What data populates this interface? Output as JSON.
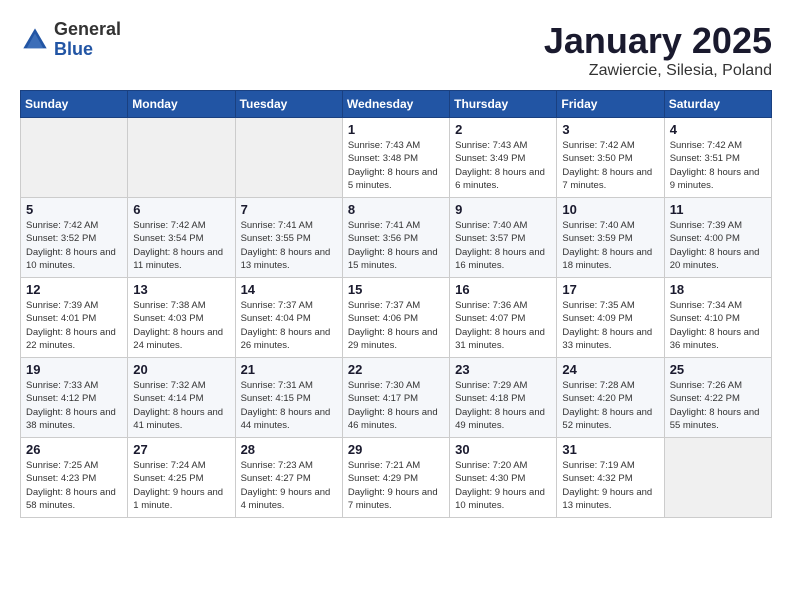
{
  "logo": {
    "general": "General",
    "blue": "Blue"
  },
  "header": {
    "title": "January 2025",
    "subtitle": "Zawiercie, Silesia, Poland"
  },
  "weekdays": [
    "Sunday",
    "Monday",
    "Tuesday",
    "Wednesday",
    "Thursday",
    "Friday",
    "Saturday"
  ],
  "weeks": [
    [
      {
        "day": "",
        "empty": true
      },
      {
        "day": "",
        "empty": true
      },
      {
        "day": "",
        "empty": true
      },
      {
        "day": "1",
        "sunrise": "7:43 AM",
        "sunset": "3:48 PM",
        "daylight": "8 hours and 5 minutes."
      },
      {
        "day": "2",
        "sunrise": "7:43 AM",
        "sunset": "3:49 PM",
        "daylight": "8 hours and 6 minutes."
      },
      {
        "day": "3",
        "sunrise": "7:42 AM",
        "sunset": "3:50 PM",
        "daylight": "8 hours and 7 minutes."
      },
      {
        "day": "4",
        "sunrise": "7:42 AM",
        "sunset": "3:51 PM",
        "daylight": "8 hours and 9 minutes."
      }
    ],
    [
      {
        "day": "5",
        "sunrise": "7:42 AM",
        "sunset": "3:52 PM",
        "daylight": "8 hours and 10 minutes."
      },
      {
        "day": "6",
        "sunrise": "7:42 AM",
        "sunset": "3:54 PM",
        "daylight": "8 hours and 11 minutes."
      },
      {
        "day": "7",
        "sunrise": "7:41 AM",
        "sunset": "3:55 PM",
        "daylight": "8 hours and 13 minutes."
      },
      {
        "day": "8",
        "sunrise": "7:41 AM",
        "sunset": "3:56 PM",
        "daylight": "8 hours and 15 minutes."
      },
      {
        "day": "9",
        "sunrise": "7:40 AM",
        "sunset": "3:57 PM",
        "daylight": "8 hours and 16 minutes."
      },
      {
        "day": "10",
        "sunrise": "7:40 AM",
        "sunset": "3:59 PM",
        "daylight": "8 hours and 18 minutes."
      },
      {
        "day": "11",
        "sunrise": "7:39 AM",
        "sunset": "4:00 PM",
        "daylight": "8 hours and 20 minutes."
      }
    ],
    [
      {
        "day": "12",
        "sunrise": "7:39 AM",
        "sunset": "4:01 PM",
        "daylight": "8 hours and 22 minutes."
      },
      {
        "day": "13",
        "sunrise": "7:38 AM",
        "sunset": "4:03 PM",
        "daylight": "8 hours and 24 minutes."
      },
      {
        "day": "14",
        "sunrise": "7:37 AM",
        "sunset": "4:04 PM",
        "daylight": "8 hours and 26 minutes."
      },
      {
        "day": "15",
        "sunrise": "7:37 AM",
        "sunset": "4:06 PM",
        "daylight": "8 hours and 29 minutes."
      },
      {
        "day": "16",
        "sunrise": "7:36 AM",
        "sunset": "4:07 PM",
        "daylight": "8 hours and 31 minutes."
      },
      {
        "day": "17",
        "sunrise": "7:35 AM",
        "sunset": "4:09 PM",
        "daylight": "8 hours and 33 minutes."
      },
      {
        "day": "18",
        "sunrise": "7:34 AM",
        "sunset": "4:10 PM",
        "daylight": "8 hours and 36 minutes."
      }
    ],
    [
      {
        "day": "19",
        "sunrise": "7:33 AM",
        "sunset": "4:12 PM",
        "daylight": "8 hours and 38 minutes."
      },
      {
        "day": "20",
        "sunrise": "7:32 AM",
        "sunset": "4:14 PM",
        "daylight": "8 hours and 41 minutes."
      },
      {
        "day": "21",
        "sunrise": "7:31 AM",
        "sunset": "4:15 PM",
        "daylight": "8 hours and 44 minutes."
      },
      {
        "day": "22",
        "sunrise": "7:30 AM",
        "sunset": "4:17 PM",
        "daylight": "8 hours and 46 minutes."
      },
      {
        "day": "23",
        "sunrise": "7:29 AM",
        "sunset": "4:18 PM",
        "daylight": "8 hours and 49 minutes."
      },
      {
        "day": "24",
        "sunrise": "7:28 AM",
        "sunset": "4:20 PM",
        "daylight": "8 hours and 52 minutes."
      },
      {
        "day": "25",
        "sunrise": "7:26 AM",
        "sunset": "4:22 PM",
        "daylight": "8 hours and 55 minutes."
      }
    ],
    [
      {
        "day": "26",
        "sunrise": "7:25 AM",
        "sunset": "4:23 PM",
        "daylight": "8 hours and 58 minutes."
      },
      {
        "day": "27",
        "sunrise": "7:24 AM",
        "sunset": "4:25 PM",
        "daylight": "9 hours and 1 minute."
      },
      {
        "day": "28",
        "sunrise": "7:23 AM",
        "sunset": "4:27 PM",
        "daylight": "9 hours and 4 minutes."
      },
      {
        "day": "29",
        "sunrise": "7:21 AM",
        "sunset": "4:29 PM",
        "daylight": "9 hours and 7 minutes."
      },
      {
        "day": "30",
        "sunrise": "7:20 AM",
        "sunset": "4:30 PM",
        "daylight": "9 hours and 10 minutes."
      },
      {
        "day": "31",
        "sunrise": "7:19 AM",
        "sunset": "4:32 PM",
        "daylight": "9 hours and 13 minutes."
      },
      {
        "day": "",
        "empty": true
      }
    ]
  ]
}
